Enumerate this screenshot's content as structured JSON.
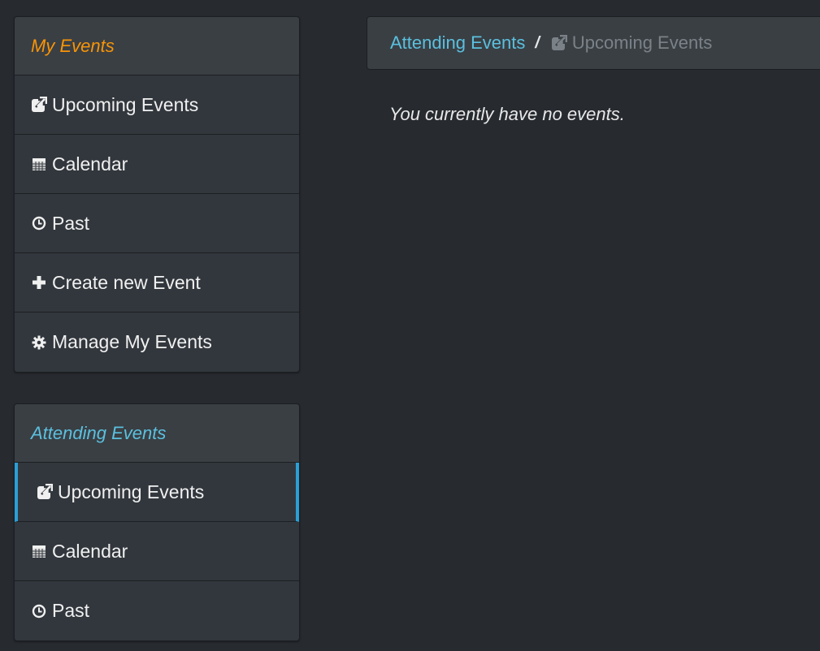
{
  "sidebar": {
    "my_events": {
      "heading": "My Events",
      "items": [
        {
          "label": "Upcoming Events",
          "icon": "external-link-icon"
        },
        {
          "label": "Calendar",
          "icon": "calendar-icon"
        },
        {
          "label": "Past",
          "icon": "clock-icon"
        },
        {
          "label": "Create new Event",
          "icon": "plus-icon"
        },
        {
          "label": "Manage My Events",
          "icon": "gear-icon"
        }
      ]
    },
    "attending_events": {
      "heading": "Attending Events",
      "items": [
        {
          "label": "Upcoming Events",
          "icon": "external-link-icon",
          "active": true
        },
        {
          "label": "Calendar",
          "icon": "calendar-icon"
        },
        {
          "label": "Past",
          "icon": "clock-icon"
        }
      ]
    }
  },
  "breadcrumb": {
    "parent": "Attending Events",
    "separator": "/",
    "current": "Upcoming Events"
  },
  "main": {
    "empty_message": "You currently have no events."
  },
  "colors": {
    "background": "#272b30",
    "panel": "#32373d",
    "accent_orange": "#f89406",
    "accent_blue": "#5bc0de",
    "active_border": "#2a9fd6"
  }
}
